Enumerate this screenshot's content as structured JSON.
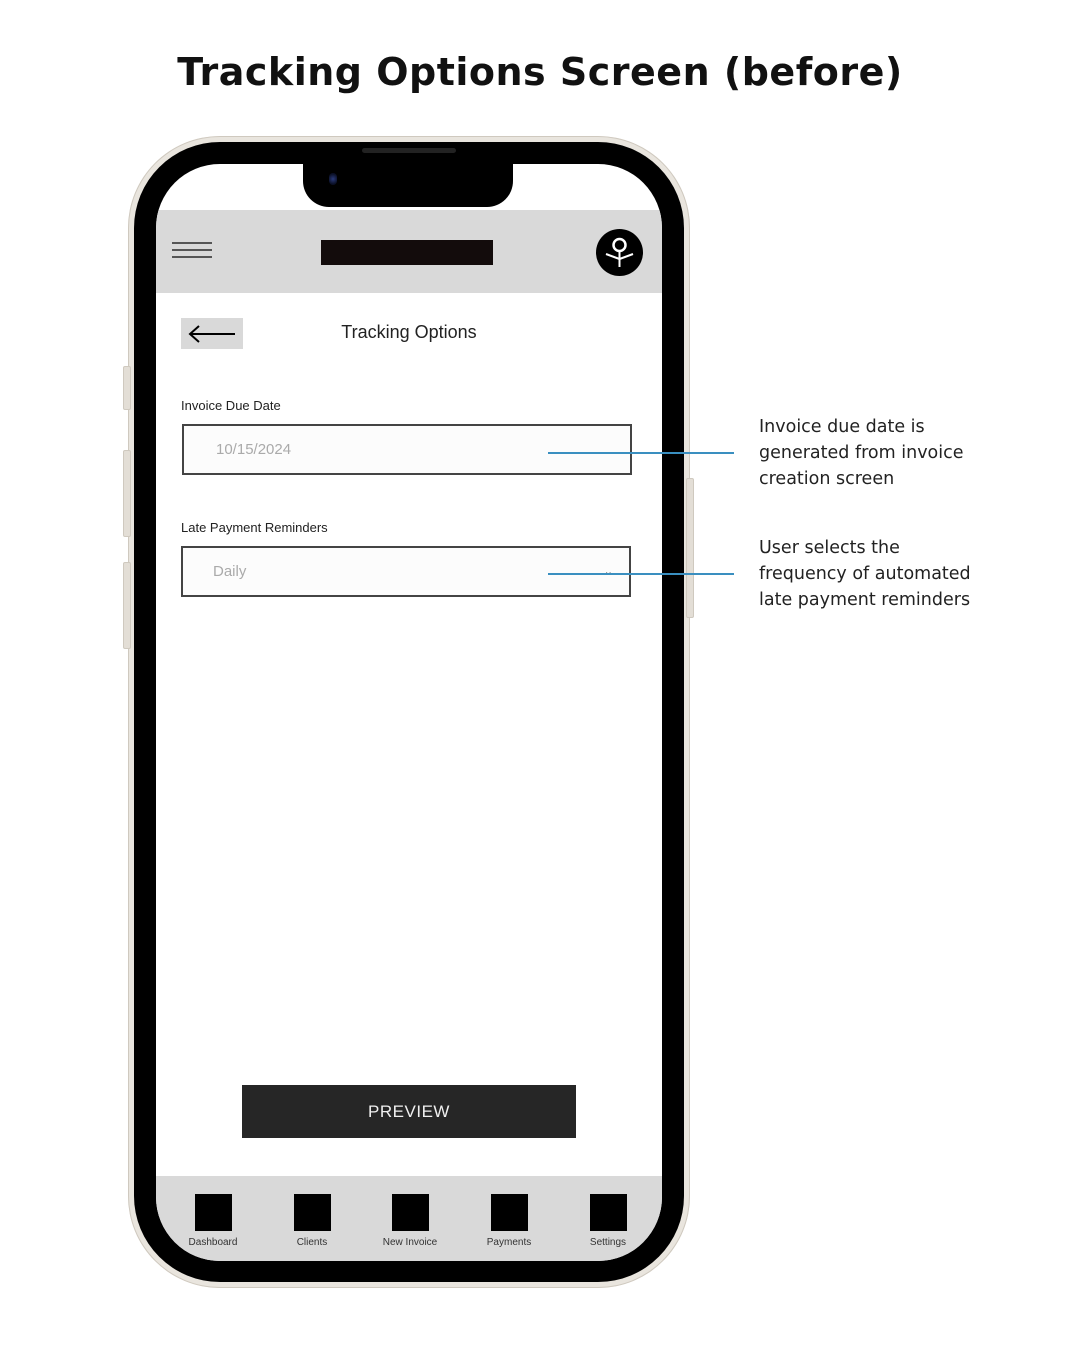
{
  "title": "Tracking Options Screen (before)",
  "phone": {
    "header": {
      "menu_icon": "hamburger-icon",
      "logo": "logo-placeholder",
      "avatar_icon": "tree-logo-icon"
    },
    "back_icon": "arrow-left-icon",
    "screen_title": "Tracking Options",
    "fields": {
      "due_date": {
        "label": "Invoice Due Date",
        "value": "10/15/2024"
      },
      "reminders": {
        "label": "Late Payment Reminders",
        "value": "Daily",
        "icon": "chevron-down-icon"
      }
    },
    "preview_button": "PREVIEW",
    "tabs": [
      {
        "label": "Dashboard"
      },
      {
        "label": "Clients"
      },
      {
        "label": "New Invoice"
      },
      {
        "label": "Payments"
      },
      {
        "label": "Settings"
      }
    ]
  },
  "annotations": [
    {
      "text_lines": [
        "Invoice due date is",
        "generated from invoice",
        "creation screen"
      ]
    },
    {
      "text_lines": [
        "User selects the",
        "frequency of automated",
        "late payment reminders"
      ]
    }
  ],
  "colors": {
    "annotation_line": "#3a8fc0",
    "header_gray": "#d9d9d9",
    "button_dark": "#262626"
  }
}
